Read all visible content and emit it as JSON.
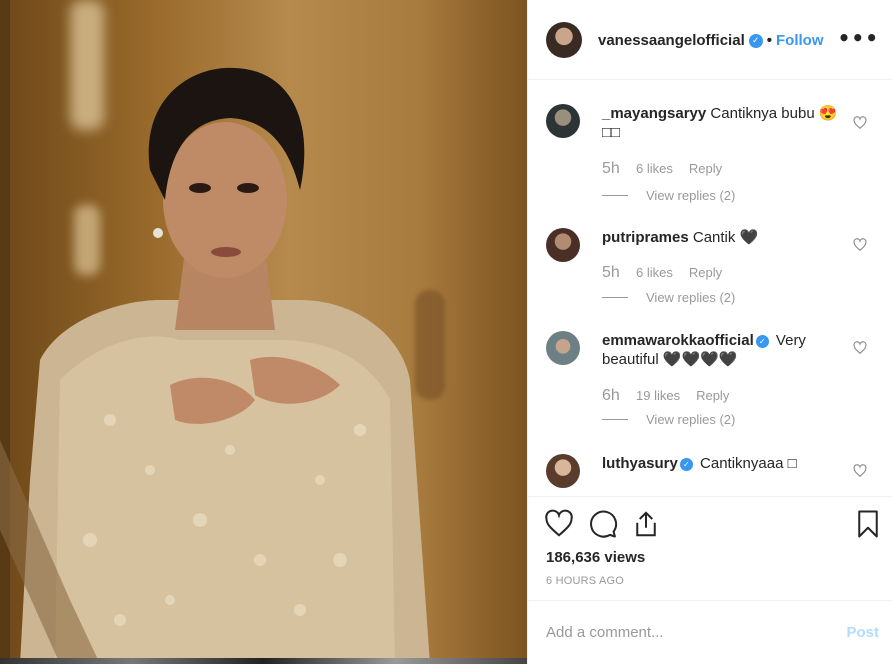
{
  "media": {
    "description_icon": "post-photo"
  },
  "header": {
    "username": "vanessaangelofficial",
    "verified": true,
    "separator": "•",
    "follow_label": "Follow",
    "more_label": "•••"
  },
  "comments": [
    {
      "username": "_mayangsaryy",
      "verified": false,
      "text": "Cantiknya bubu 😍 □□",
      "age": "5h",
      "likes": "6 likes",
      "reply": "Reply",
      "view_replies": "View replies (2)"
    },
    {
      "username": "putriprames",
      "verified": false,
      "text": "Cantik 🖤",
      "age": "5h",
      "likes": "6 likes",
      "reply": "Reply",
      "view_replies": "View replies (2)"
    },
    {
      "username": "emmawarokkaofficial",
      "verified": true,
      "text": "Very beautiful 🖤🖤🖤🖤",
      "age": "6h",
      "likes": "19 likes",
      "reply": "Reply",
      "view_replies": "View replies (2)"
    },
    {
      "username": "luthyasury",
      "verified": true,
      "text": "Cantiknyaaa □",
      "age": "",
      "likes": "",
      "reply": "",
      "view_replies": ""
    }
  ],
  "actions": {
    "views": "186,636 views",
    "time_ago": "6 HOURS AGO",
    "icons": [
      "heart-icon",
      "comment-icon",
      "share-icon",
      "bookmark-icon"
    ]
  },
  "add_comment": {
    "placeholder": "Add a comment...",
    "post_label": "Post"
  },
  "colors": {
    "accent": "#3897f0",
    "muted": "#999999",
    "post_disabled": "#b3dbff",
    "border": "#efefef"
  }
}
